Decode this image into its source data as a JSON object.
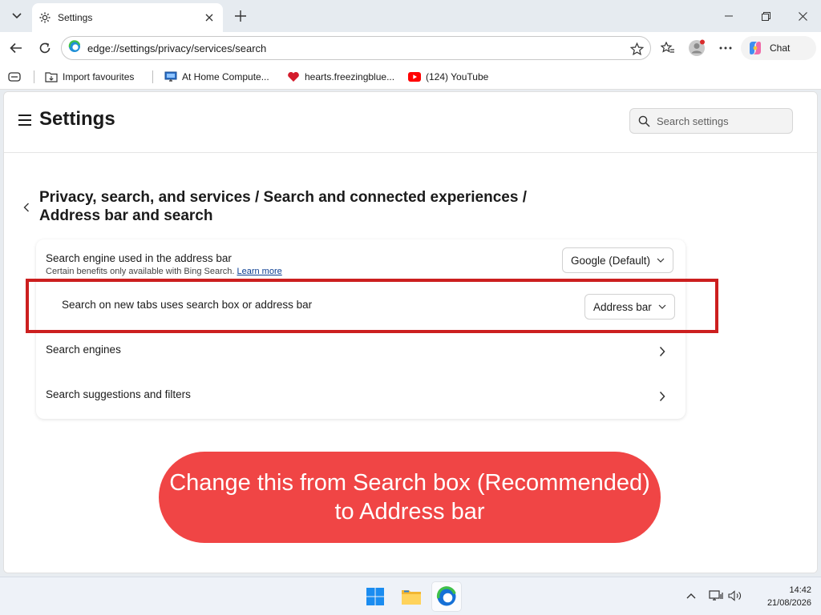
{
  "browser": {
    "tab": {
      "title": "Settings"
    },
    "address": {
      "url": "edge://settings/privacy/services/search"
    },
    "chat_label": "Chat"
  },
  "favorites": [
    {
      "label": "Import favourites",
      "icon": "folder-import-icon"
    },
    {
      "label": "At Home Compute...",
      "icon": "monitor-icon"
    },
    {
      "label": "hearts.freezingblue...",
      "icon": "heart-icon"
    },
    {
      "label": "(124) YouTube",
      "icon": "youtube-icon"
    }
  ],
  "settings": {
    "title": "Settings",
    "search_placeholder": "Search settings",
    "breadcrumb": "Privacy, search, and services / Search and connected experiences / Address bar and search",
    "rows": {
      "engine": {
        "title": "Search engine used in the address bar",
        "subtitle": "Certain benefits only available with Bing Search.",
        "link": "Learn more",
        "value": "Google (Default)"
      },
      "new_tabs": {
        "title": "Search on new tabs uses search box or address bar",
        "value": "Address bar"
      },
      "engines": {
        "title": "Search engines"
      },
      "suggestions": {
        "title": "Search suggestions and filters"
      }
    }
  },
  "annotation": {
    "text": "Change this from Search box (Recommended) to Address bar",
    "color": "#f04545",
    "box_color": "#cc1f1f"
  },
  "taskbar": {
    "time": "14:42",
    "date": "21/08/2026"
  }
}
